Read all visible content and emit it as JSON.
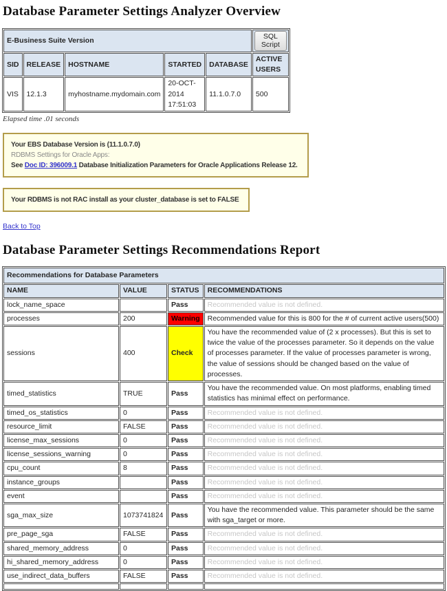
{
  "colors": {
    "header_bg": "#dbe5f1",
    "table_border": "#4d4d4d",
    "warning_bg": "#ff0000",
    "check_bg": "#ffff00",
    "notice_border": "#b39c4a",
    "notice_bg": "#ffffe9",
    "link_blue": "#3333cc",
    "muted_text": "#c6c6c6"
  },
  "page": {
    "overview_title": "Database Parameter Settings Analyzer Overview",
    "report_title": "Database Parameter Settings Recommendations Report",
    "elapsed_time": "Elapsed time .01 seconds",
    "back_to_top": "Back to Top"
  },
  "ebs_table": {
    "caption": "E-Business Suite Version",
    "sql_script_label": "SQL Script",
    "columns": [
      "SID",
      "RELEASE",
      "HOSTNAME",
      "STARTED",
      "DATABASE",
      "ACTIVE USERS"
    ],
    "row": {
      "sid": "VIS",
      "release": "12.1.3",
      "hostname": "myhostname.mydomain.com",
      "started": "20-OCT-2014 17:51:03",
      "database": "11.1.0.7.0",
      "active_users": "500"
    }
  },
  "notices": {
    "ebs_version": {
      "line1": "Your EBS Database Version is (11.1.0.7.0)",
      "line2": "RDBMS Settings for Oracle Apps:",
      "line3_prefix": "See ",
      "line3_link": "Doc ID: 396009.1",
      "line3_suffix": " Database Initialization Parameters for Oracle Applications Release 12."
    },
    "rac": {
      "line1": "Your RDBMS is not RAC install as your cluster_database is set to FALSE"
    }
  },
  "recommendations_table": {
    "caption": "Recommendations for Database Parameters",
    "columns": [
      "NAME",
      "VALUE",
      "STATUS",
      "RECOMMENDATIONS"
    ],
    "rows": [
      {
        "name": "lock_name_space",
        "value": "",
        "status": "Pass",
        "recommendation": "Recommended value is not defined.",
        "muted": true
      },
      {
        "name": "processes",
        "value": "200",
        "status": "Warning",
        "recommendation": "Recommended value for this is 800 for the # of current active users(500)",
        "muted": false
      },
      {
        "name": "sessions",
        "value": "400",
        "status": "Check",
        "recommendation": "You have the recommended value of (2 x processes). But this is set to twice the value of the processes parameter. So it depends on the value of processes parameter. If the value of processes parameter is wrong, the value of sessions should be changed based on the value of processes.",
        "muted": false
      },
      {
        "name": "timed_statistics",
        "value": "TRUE",
        "status": "Pass",
        "recommendation": "You have the recommended value. On most platforms, enabling timed statistics has minimal effect on performance.",
        "muted": false
      },
      {
        "name": "timed_os_statistics",
        "value": "0",
        "status": "Pass",
        "recommendation": "Recommended value is not defined.",
        "muted": true
      },
      {
        "name": "resource_limit",
        "value": "FALSE",
        "status": "Pass",
        "recommendation": "Recommended value is not defined.",
        "muted": true
      },
      {
        "name": "license_max_sessions",
        "value": "0",
        "status": "Pass",
        "recommendation": "Recommended value is not defined.",
        "muted": true
      },
      {
        "name": "license_sessions_warning",
        "value": "0",
        "status": "Pass",
        "recommendation": "Recommended value is not defined.",
        "muted": true
      },
      {
        "name": "cpu_count",
        "value": "8",
        "status": "Pass",
        "recommendation": "Recommended value is not defined.",
        "muted": true
      },
      {
        "name": "instance_groups",
        "value": "",
        "status": "Pass",
        "recommendation": "Recommended value is not defined.",
        "muted": true
      },
      {
        "name": "event",
        "value": "",
        "status": "Pass",
        "recommendation": "Recommended value is not defined.",
        "muted": true
      },
      {
        "name": "sga_max_size",
        "value": "1073741824",
        "status": "Pass",
        "recommendation": "You have the recommended value. This parameter should be the same with sga_target or more.",
        "muted": false
      },
      {
        "name": "pre_page_sga",
        "value": "FALSE",
        "status": "Pass",
        "recommendation": "Recommended value is not defined.",
        "muted": true
      },
      {
        "name": "shared_memory_address",
        "value": "0",
        "status": "Pass",
        "recommendation": "Recommended value is not defined.",
        "muted": true
      },
      {
        "name": "hi_shared_memory_address",
        "value": "0",
        "status": "Pass",
        "recommendation": "Recommended value is not defined.",
        "muted": true
      },
      {
        "name": "use_indirect_data_buffers",
        "value": "FALSE",
        "status": "Pass",
        "recommendation": "Recommended value is not defined.",
        "muted": true
      }
    ]
  }
}
